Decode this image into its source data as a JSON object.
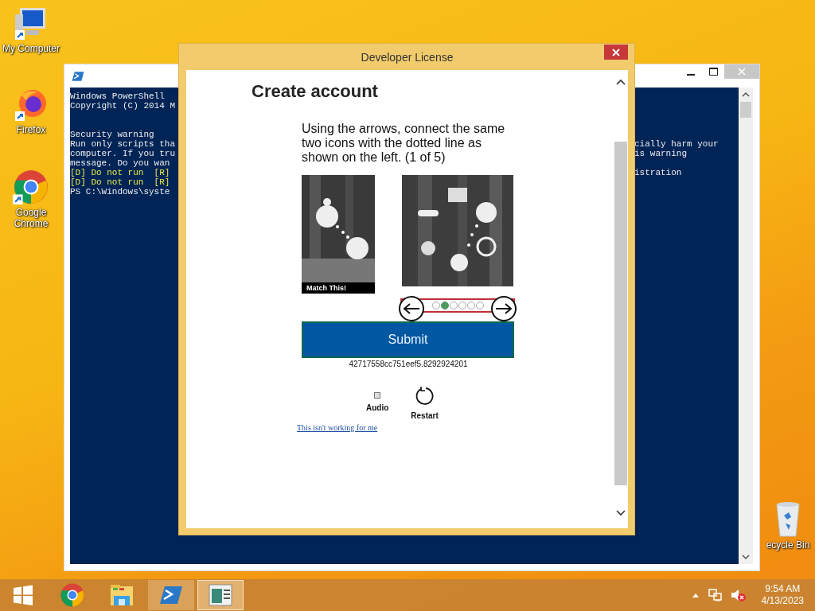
{
  "desktop_icons": [
    {
      "label": "My Computer",
      "kind": "computer"
    },
    {
      "label": "Firefox",
      "kind": "firefox"
    },
    {
      "label": "Google Chrome",
      "kind": "chrome"
    }
  ],
  "recycle_bin": {
    "label": "ecycle Bin"
  },
  "console_window": {
    "lines": [
      {
        "left": "Windows PowerShell"
      },
      {
        "left": "Copyright (C) 2014 M"
      },
      {
        "left": "Security warning",
        "kind": "new_block"
      },
      {
        "left": "Run only scripts tha",
        "right": "cially harm your"
      },
      {
        "left": "computer. If you tru",
        "right": "is warning"
      },
      {
        "left": "message. Do you wan"
      },
      {
        "left": "[D] Do not run  [R]",
        "kind": "option",
        "right": "istration"
      },
      {
        "left": "[D] Do not run  [R]",
        "kind": "option"
      },
      {
        "left": "PS C:\\Windows\\syste"
      }
    ]
  },
  "dialog": {
    "title": "Developer License",
    "heading": "Create account",
    "instruction": "Using the arrows, connect the same two icons with the dotted line as shown on the left. (1 of 5)",
    "sample_caption": "Match This!",
    "dots": [
      {
        "selected": false
      },
      {
        "selected": true
      },
      {
        "selected": false
      },
      {
        "selected": false
      },
      {
        "selected": false
      },
      {
        "selected": false
      }
    ],
    "submit": "Submit",
    "token": "42717558cc751eef5.8292924201",
    "audio": "Audio",
    "restart": "Restart",
    "help_link": "This isn't working for me"
  },
  "taskbar": {
    "items": [
      {
        "kind": "start",
        "running": false,
        "selected": false
      },
      {
        "kind": "chrome",
        "running": false,
        "selected": false
      },
      {
        "kind": "explorer",
        "running": false,
        "selected": false
      },
      {
        "kind": "powershell",
        "running": true,
        "selected": false
      },
      {
        "kind": "license",
        "running": true,
        "selected": true
      }
    ],
    "volume_muted": true,
    "time": "9:54 AM",
    "date": "4/13/2023"
  }
}
